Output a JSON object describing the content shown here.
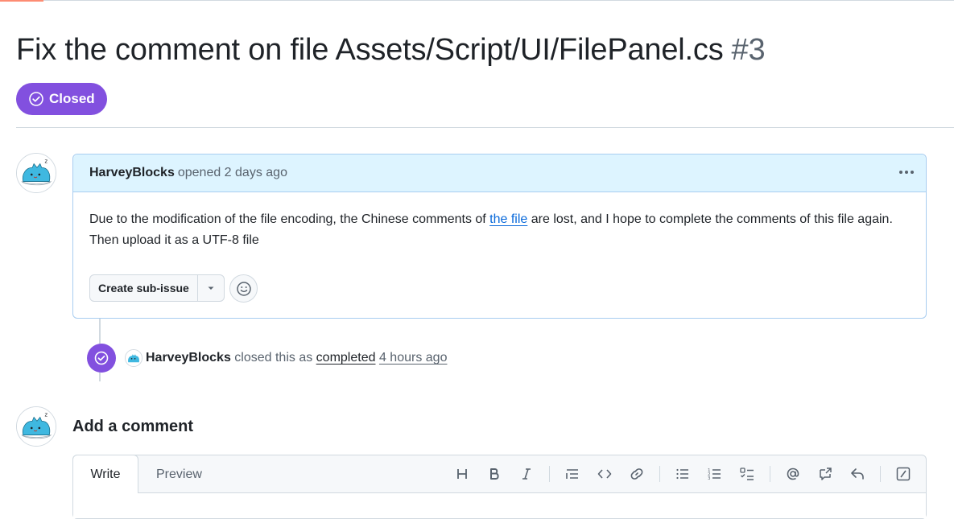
{
  "issue": {
    "title": "Fix the comment on file Assets/Script/UI/FilePanel.cs",
    "number": "#3",
    "state": "Closed"
  },
  "comment": {
    "author": "HarveyBlocks",
    "meta": "opened 2 days ago",
    "body_before": "Due to the modification of the file encoding, the Chinese comments of ",
    "body_link": "the file",
    "body_after": " are lost, and I hope to complete the comments of this file again. Then upload it as a UTF-8 file",
    "create_sub_issue_label": "Create sub-issue"
  },
  "event": {
    "author": "HarveyBlocks",
    "text_before": " closed this as ",
    "completed": "completed",
    "time": "4 hours ago"
  },
  "add_comment": {
    "heading": "Add a comment",
    "tabs": [
      "Write",
      "Preview"
    ]
  },
  "toolbar": {
    "items": [
      "heading",
      "bold",
      "italic",
      "quote",
      "code",
      "link",
      "unordered-list",
      "ordered-list",
      "task-list",
      "mention",
      "reference",
      "saved-reply",
      "slash-command"
    ]
  },
  "colors": {
    "closed_purple": "#8250df",
    "link_blue": "#0969da",
    "header_blue": "#ddf4ff"
  }
}
